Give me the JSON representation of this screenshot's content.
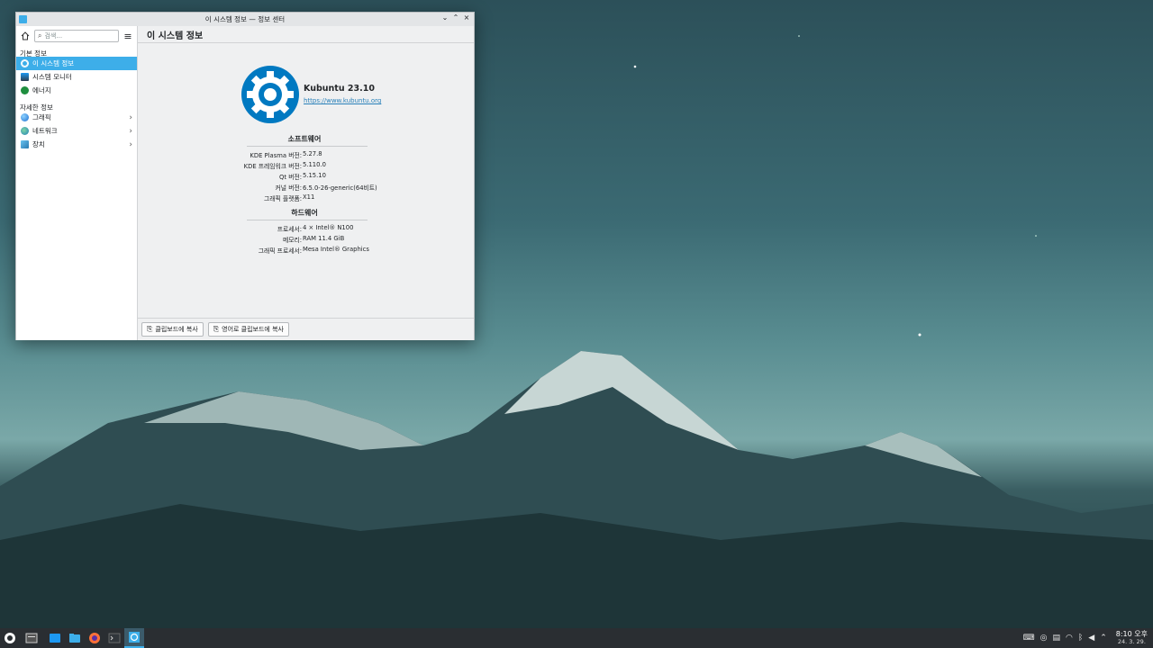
{
  "window": {
    "title": "이 시스템 정보 — 정보 센터",
    "controls": [
      "⌄",
      "⌃",
      "×"
    ]
  },
  "sidebar": {
    "search_placeholder": "검색...",
    "section_basic": "기본 정보",
    "basic_items": [
      {
        "label": "이 시스템 정보",
        "icon": "info-icon",
        "active": true
      },
      {
        "label": "시스템 모니터",
        "icon": "system-monitor-icon"
      },
      {
        "label": "에너지",
        "icon": "energy-icon"
      }
    ],
    "section_detail": "자세한 정보",
    "detail_items": [
      {
        "label": "그래픽",
        "icon": "graphics-icon"
      },
      {
        "label": "네트워크",
        "icon": "network-icon"
      },
      {
        "label": "장치",
        "icon": "devices-icon"
      }
    ]
  },
  "main": {
    "header": "이 시스템 정보",
    "distro_name": "Kubuntu 23.10",
    "distro_url": "https://www.kubuntu.org",
    "software_title": "소프트웨어",
    "software": [
      {
        "key": "KDE Plasma 버전:",
        "value": "5.27.8"
      },
      {
        "key": "KDE 프레임워크 버전:",
        "value": "5.110.0"
      },
      {
        "key": "Qt 버전:",
        "value": "5.15.10"
      },
      {
        "key": "커널 버전:",
        "value": "6.5.0-26-generic(64비트)"
      },
      {
        "key": "그래픽 플랫폼:",
        "value": "X11"
      }
    ],
    "hardware_title": "하드웨어",
    "hardware": [
      {
        "key": "프로세서:",
        "value": "4 × Intel® N100"
      },
      {
        "key": "메모리:",
        "value": "RAM 11.4 GiB"
      },
      {
        "key": "그래픽 프로세서:",
        "value": "Mesa Intel® Graphics"
      }
    ],
    "copy_button": "클립보드에 복사",
    "copy_english_button": "영어로 클립보드에 복사"
  },
  "taskbar": {
    "time": "8:10 오후",
    "date": "24. 3. 29."
  },
  "colors": {
    "accent": "#3daee9",
    "logo": "#0079c1"
  }
}
